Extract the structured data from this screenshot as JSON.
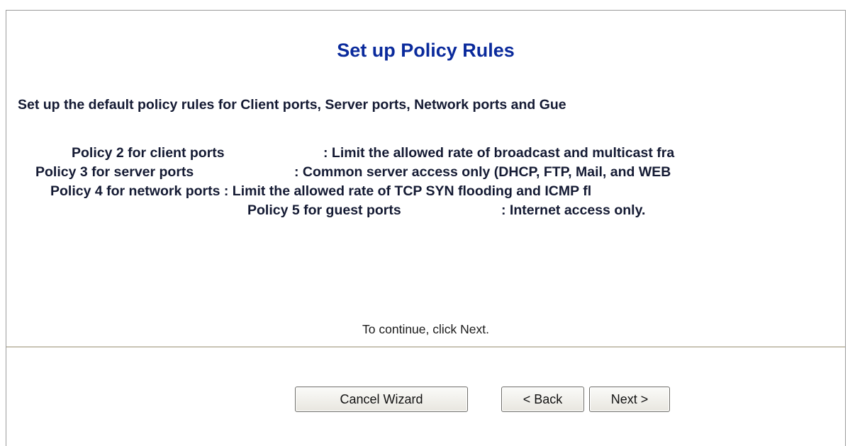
{
  "wizard": {
    "title": "Set up Policy Rules",
    "intro": "Set up the default policy rules for Client ports, Server ports, Network ports and Gue",
    "policies": [
      {
        "label": "Policy 2 for client ports",
        "description": ": Limit the allowed rate of broadcast and multicast fra"
      },
      {
        "label": "Policy 3 for server ports",
        "description": ": Common server access only (DHCP, FTP, Mail, and WEB"
      },
      {
        "label": "Policy 4 for network ports",
        "description": ": Limit the allowed rate of TCP SYN flooding and ICMP fl"
      },
      {
        "label": "Policy 5 for guest ports",
        "description": ": Internet access only."
      }
    ],
    "continue_text": "To continue, click Next."
  },
  "buttons": {
    "cancel_label": "Cancel Wizard",
    "back_label": "< Back",
    "next_label": "Next >"
  },
  "colors": {
    "title": "#0a2a9c",
    "text": "#141a33",
    "divider": "#c8c3b4",
    "border": "#9a9a9a"
  }
}
